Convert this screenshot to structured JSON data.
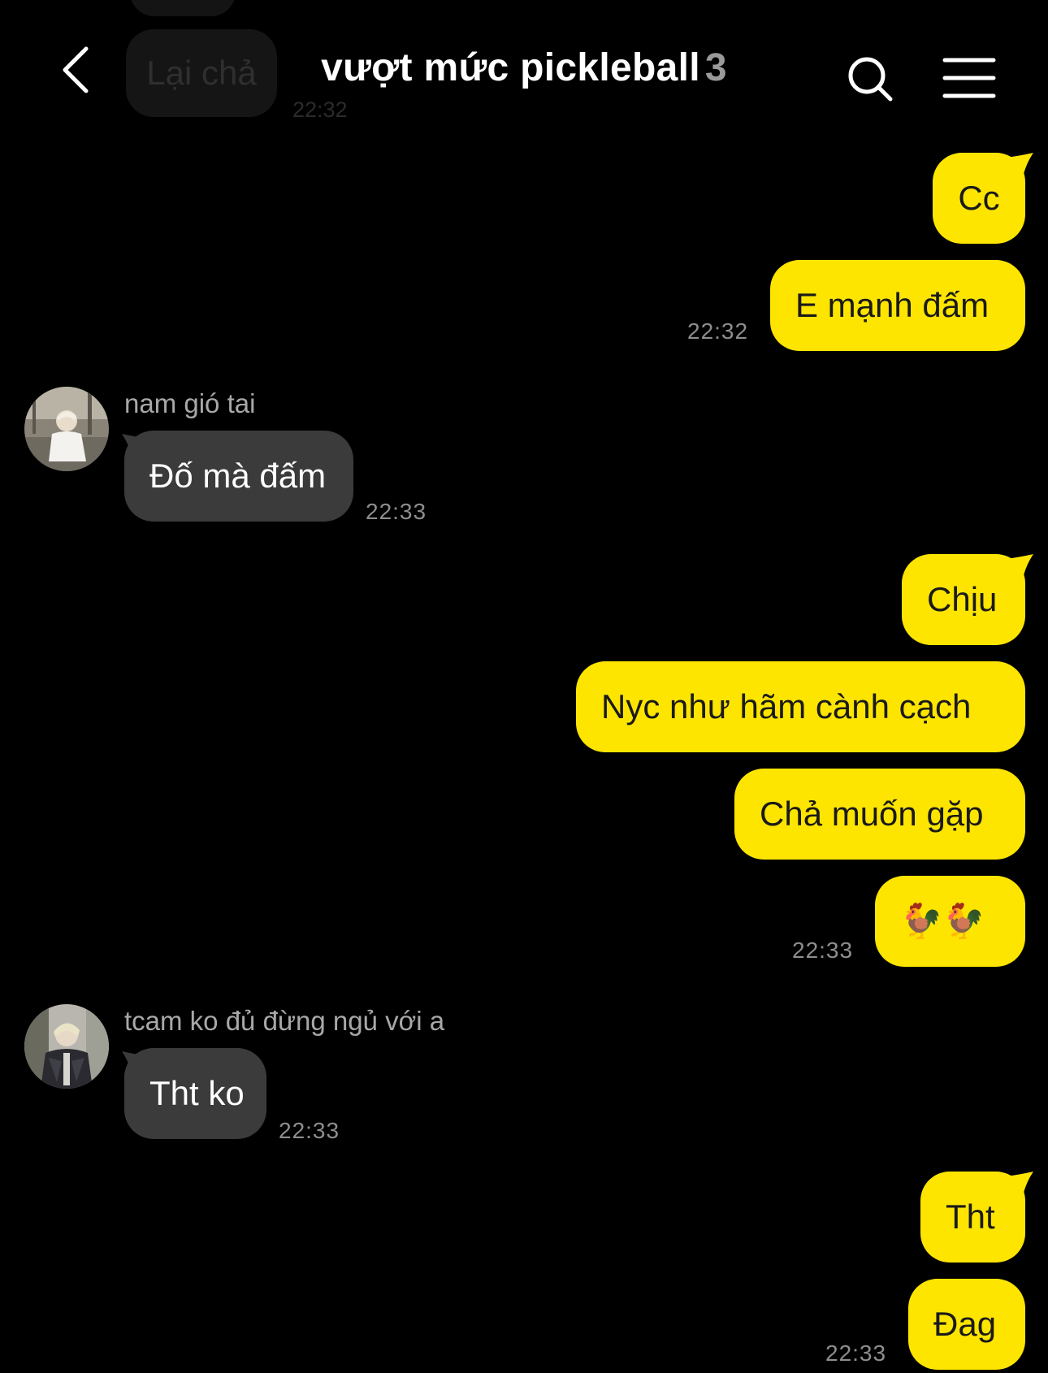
{
  "header": {
    "title": "vượt mức pickleball",
    "member_count": "3"
  },
  "ghost": {
    "text": "Lại chả",
    "time": "22:32"
  },
  "messages": [
    {
      "sender": "me",
      "text": "Cc"
    },
    {
      "sender": "me",
      "text": "E mạnh đấm",
      "time": "22:32"
    },
    {
      "sender": "nam gió tai",
      "text": "Đố mà đấm",
      "time": "22:33"
    },
    {
      "sender": "me",
      "text": "Chịu"
    },
    {
      "sender": "me",
      "text": "Nyc như hãm cành cạch"
    },
    {
      "sender": "me",
      "text": "Chả muốn gặp"
    },
    {
      "sender": "me",
      "text": "🐓🐓",
      "time": "22:33"
    },
    {
      "sender": "tcam ko đủ đừng ngủ với a",
      "text": "Tht ko",
      "time": "22:33"
    },
    {
      "sender": "me",
      "text": "Tht"
    },
    {
      "sender": "me",
      "text": "Đag",
      "time": "22:33"
    }
  ],
  "colors": {
    "background": "#000000",
    "my_bubble": "#fde500",
    "their_bubble": "#3b3b3b",
    "timestamp": "#8e8e8e"
  },
  "icons": {
    "back": "chevron-left-icon",
    "search": "search-icon",
    "menu": "hamburger-menu-icon"
  }
}
